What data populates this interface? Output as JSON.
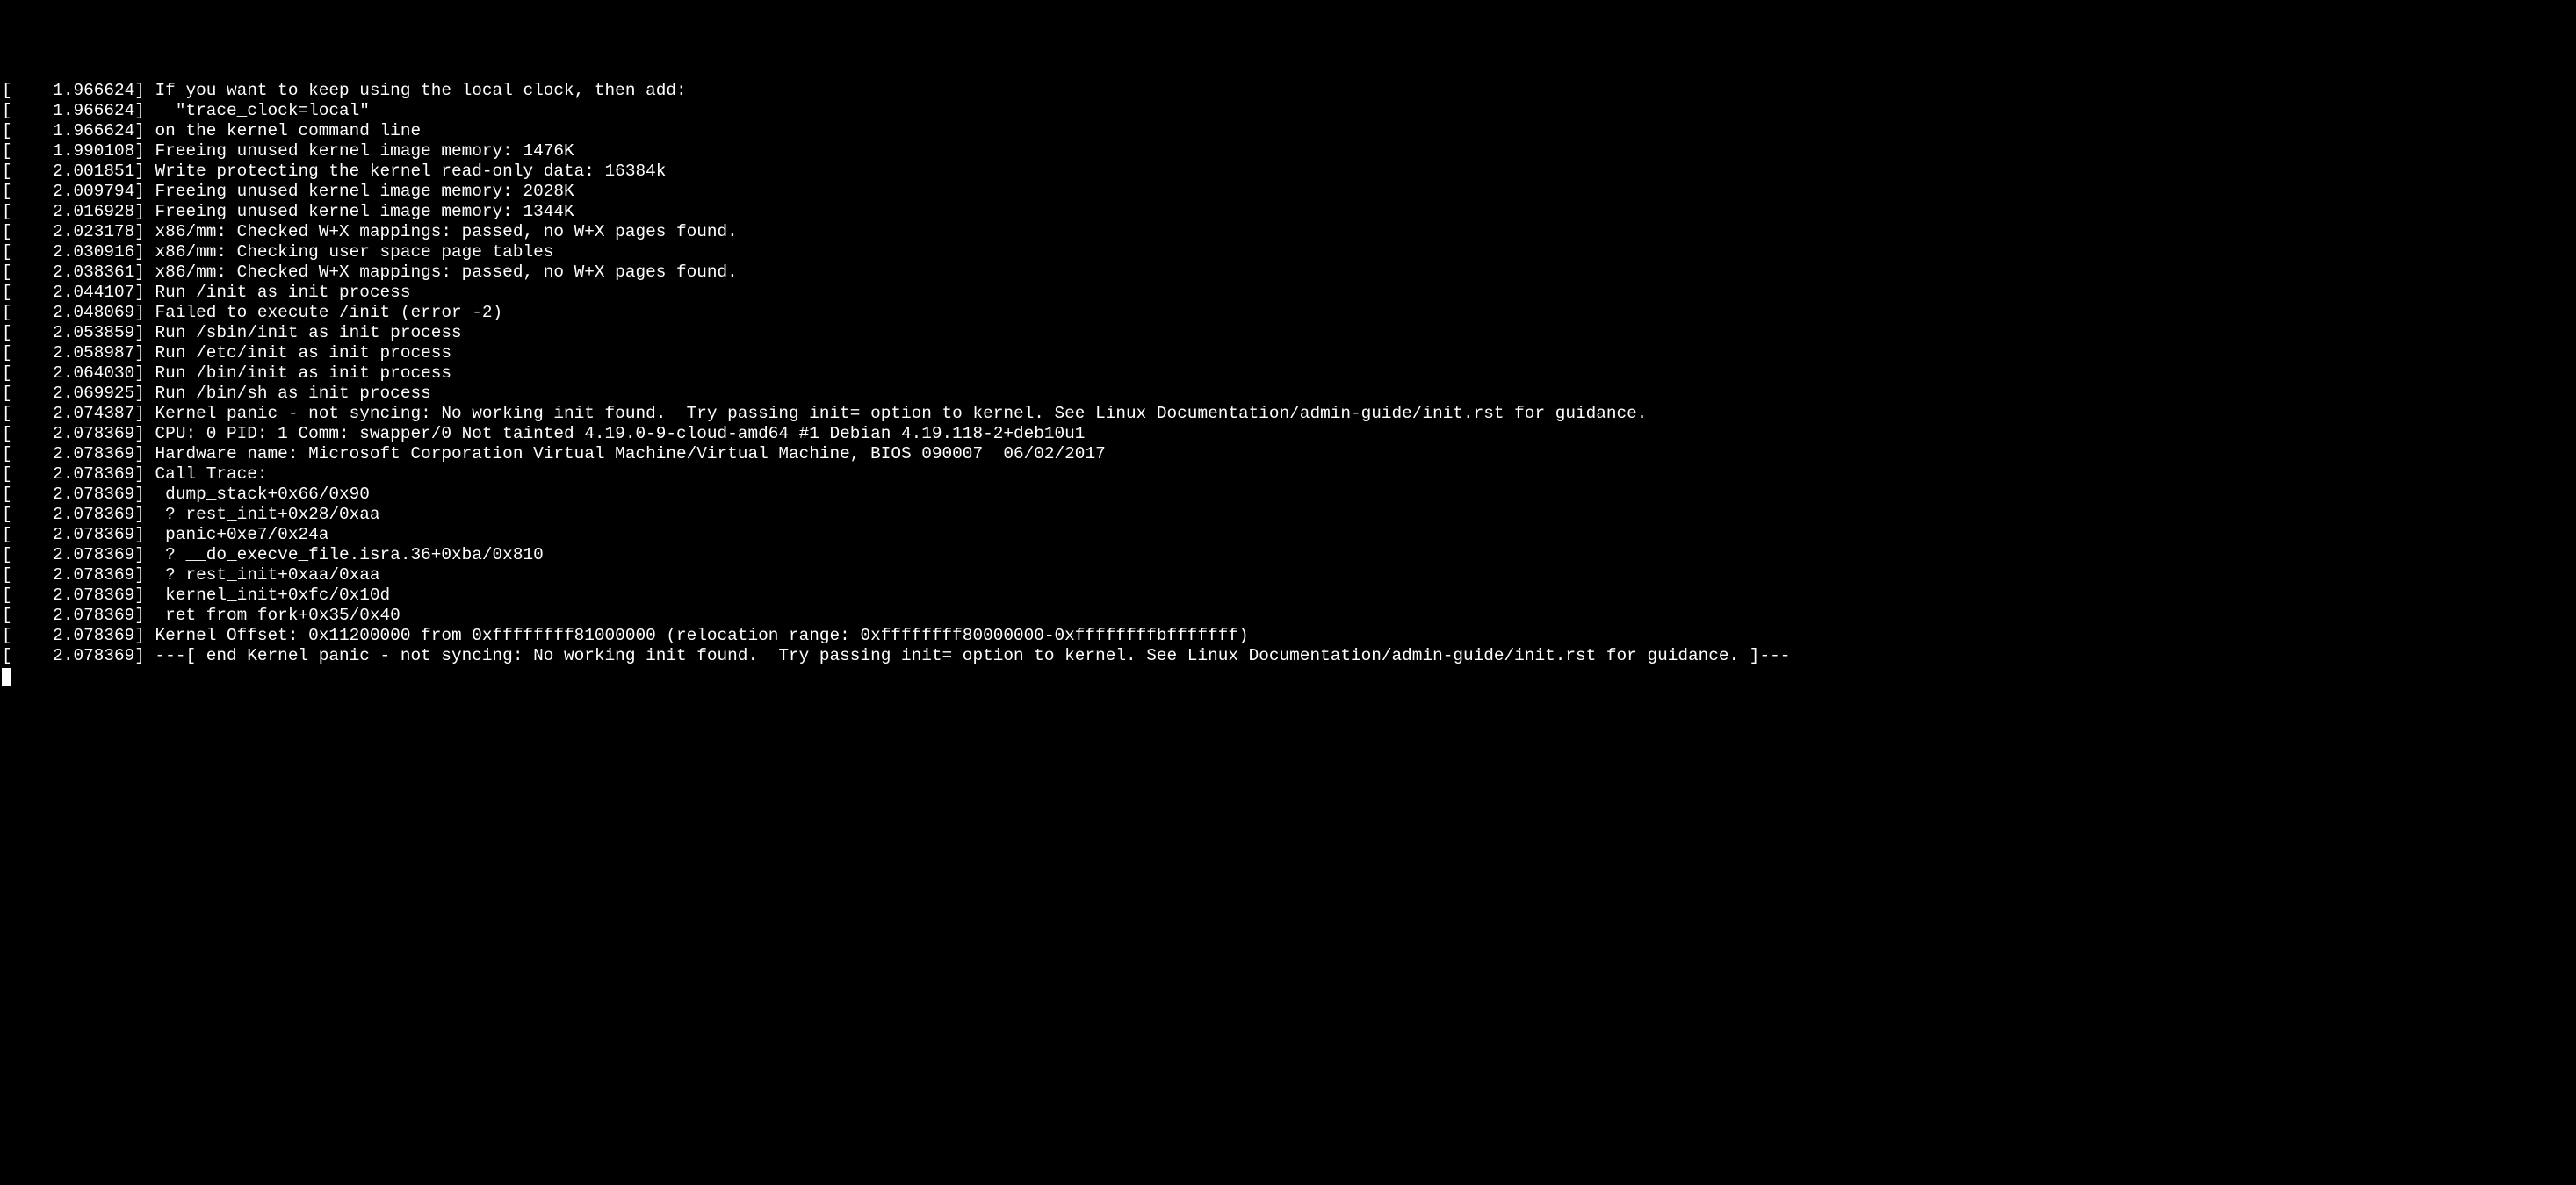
{
  "console": {
    "lines": [
      {
        "ts": "1.966624",
        "msg": "If you want to keep using the local clock, then add:"
      },
      {
        "ts": "1.966624",
        "msg": "  \"trace_clock=local\""
      },
      {
        "ts": "1.966624",
        "msg": "on the kernel command line"
      },
      {
        "ts": "1.990108",
        "msg": "Freeing unused kernel image memory: 1476K"
      },
      {
        "ts": "2.001851",
        "msg": "Write protecting the kernel read-only data: 16384k"
      },
      {
        "ts": "2.009794",
        "msg": "Freeing unused kernel image memory: 2028K"
      },
      {
        "ts": "2.016928",
        "msg": "Freeing unused kernel image memory: 1344K"
      },
      {
        "ts": "2.023178",
        "msg": "x86/mm: Checked W+X mappings: passed, no W+X pages found."
      },
      {
        "ts": "2.030916",
        "msg": "x86/mm: Checking user space page tables"
      },
      {
        "ts": "2.038361",
        "msg": "x86/mm: Checked W+X mappings: passed, no W+X pages found."
      },
      {
        "ts": "2.044107",
        "msg": "Run /init as init process"
      },
      {
        "ts": "2.048069",
        "msg": "Failed to execute /init (error -2)"
      },
      {
        "ts": "2.053859",
        "msg": "Run /sbin/init as init process"
      },
      {
        "ts": "2.058987",
        "msg": "Run /etc/init as init process"
      },
      {
        "ts": "2.064030",
        "msg": "Run /bin/init as init process"
      },
      {
        "ts": "2.069925",
        "msg": "Run /bin/sh as init process"
      },
      {
        "ts": "2.074387",
        "msg": "Kernel panic - not syncing: No working init found.  Try passing init= option to kernel. See Linux Documentation/admin-guide/init.rst for guidance."
      },
      {
        "ts": "2.078369",
        "msg": "CPU: 0 PID: 1 Comm: swapper/0 Not tainted 4.19.0-9-cloud-amd64 #1 Debian 4.19.118-2+deb10u1"
      },
      {
        "ts": "2.078369",
        "msg": "Hardware name: Microsoft Corporation Virtual Machine/Virtual Machine, BIOS 090007  06/02/2017"
      },
      {
        "ts": "2.078369",
        "msg": "Call Trace:"
      },
      {
        "ts": "2.078369",
        "msg": " dump_stack+0x66/0x90"
      },
      {
        "ts": "2.078369",
        "msg": " ? rest_init+0x28/0xaa"
      },
      {
        "ts": "2.078369",
        "msg": " panic+0xe7/0x24a"
      },
      {
        "ts": "2.078369",
        "msg": " ? __do_execve_file.isra.36+0xba/0x810"
      },
      {
        "ts": "2.078369",
        "msg": " ? rest_init+0xaa/0xaa"
      },
      {
        "ts": "2.078369",
        "msg": " kernel_init+0xfc/0x10d"
      },
      {
        "ts": "2.078369",
        "msg": " ret_from_fork+0x35/0x40"
      },
      {
        "ts": "2.078369",
        "msg": "Kernel Offset: 0x11200000 from 0xffffffff81000000 (relocation range: 0xffffffff80000000-0xffffffffbfffffff)"
      },
      {
        "ts": "2.078369",
        "msg": "---[ end Kernel panic - not syncing: No working init found.  Try passing init= option to kernel. See Linux Documentation/admin-guide/init.rst for guidance. ]---"
      }
    ]
  }
}
